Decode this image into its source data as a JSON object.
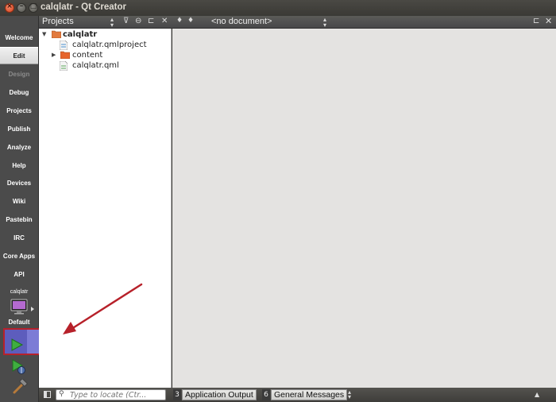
{
  "window": {
    "title": "calqlatr - Qt Creator",
    "close_glyph": "×",
    "minimize_glyph": "–",
    "maximize_glyph": "□"
  },
  "modes": [
    {
      "label": "Welcome",
      "state": "normal"
    },
    {
      "label": "Edit",
      "state": "active"
    },
    {
      "label": "Design",
      "state": "disabled"
    },
    {
      "label": "Debug",
      "state": "normal"
    },
    {
      "label": "Projects",
      "state": "normal"
    },
    {
      "label": "Publish",
      "state": "normal"
    },
    {
      "label": "Analyze",
      "state": "normal"
    },
    {
      "label": "Help",
      "state": "normal"
    },
    {
      "label": "Devices",
      "state": "normal"
    },
    {
      "label": "Wiki",
      "state": "normal"
    },
    {
      "label": "Pastebin",
      "state": "normal"
    },
    {
      "label": "IRC",
      "state": "normal"
    },
    {
      "label": "Core Apps",
      "state": "normal"
    },
    {
      "label": "API",
      "state": "normal"
    }
  ],
  "target_selector": {
    "project": "calqlatr",
    "configuration": "Default",
    "icon": "monitor-icon"
  },
  "run_controls": {
    "run_icon": "run-icon",
    "debug_icon": "debug-run-icon",
    "build_icon": "build-hammer-icon"
  },
  "projects_pane": {
    "title": "Projects",
    "tree": [
      {
        "label": "calqlatr",
        "level": 0,
        "expanded": true,
        "bold": true,
        "icon": "project-folder-icon"
      },
      {
        "label": "calqlatr.qmlproject",
        "level": 1,
        "icon": "qmlproject-file-icon"
      },
      {
        "label": "content",
        "level": 1,
        "expanded": false,
        "icon": "folder-icon"
      },
      {
        "label": "calqlatr.qml",
        "level": 1,
        "icon": "qml-file-icon"
      }
    ]
  },
  "editor": {
    "document_combo": "<no document>",
    "back_glyph": "♦",
    "forward_glyph": "♦",
    "close_glyph": "✕",
    "background": "#e4e3e1"
  },
  "statusbar": {
    "locator_placeholder": "Type to locate (Ctr...",
    "output_tabs": [
      {
        "number": "3",
        "label": "Application Output"
      },
      {
        "number": "6",
        "label": "General Messages"
      }
    ]
  },
  "annotation": {
    "color": "#b7212a",
    "target": "run-button"
  }
}
